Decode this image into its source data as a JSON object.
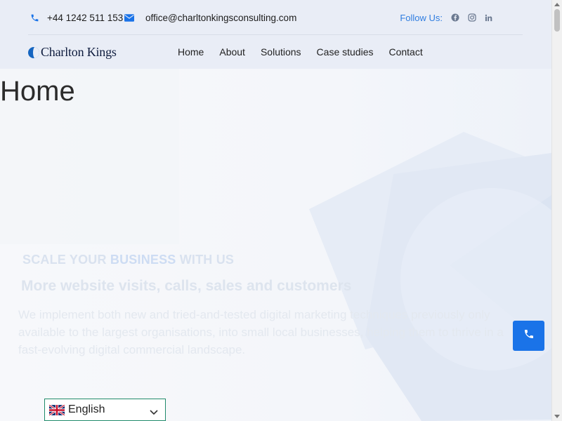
{
  "topbar": {
    "phone_icon": "phone-icon",
    "phone": "+44 1242 511 153",
    "email_icon": "envelope-icon",
    "email": "office@charltonkingsconsulting.com",
    "follow_label": "Follow Us:",
    "social": [
      "facebook-icon",
      "instagram-icon",
      "linkedin-icon"
    ]
  },
  "brand": {
    "name": "Charlton Kings"
  },
  "nav": {
    "items": [
      {
        "label": "Home"
      },
      {
        "label": "About"
      },
      {
        "label": "Solutions"
      },
      {
        "label": "Case studies"
      },
      {
        "label": "Contact"
      }
    ]
  },
  "hero": {
    "title": "Home",
    "tagline_part1": "SCALE YOUR ",
    "tagline_highlight": "BUSINESS",
    "tagline_part2": " WITH US",
    "subheading": "More website visits, calls, sales and customers",
    "description": "We implement both new and tried-and-tested digital marketing techniques previously only available to the largest organisations, into small local businesses, helping them to thrive in a fast-evolving digital commercial landscape."
  },
  "language": {
    "selected": "English",
    "flag": "uk-flag-icon"
  },
  "colors": {
    "accent": "#1a73e8",
    "header_bg": "#e9edf6",
    "follow_text": "#2f7de0"
  }
}
